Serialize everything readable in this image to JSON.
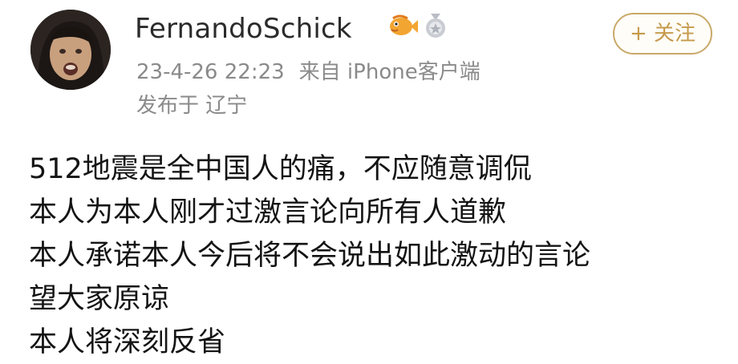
{
  "post": {
    "user": {
      "name": "FernandoSchick",
      "badges": [
        "fish-badge-icon",
        "medal-badge-icon"
      ]
    },
    "timestamp": "23-4-26 22:23",
    "source": "来自 iPhone客户端",
    "location": "发布于 辽宁",
    "follow_label": "+ 关注",
    "body_lines": [
      "512地震是全中国人的痛，不应随意调侃",
      "本人为本人刚才过激言论向所有人道歉",
      "本人承诺本人今后将不会说出如此激动的言论",
      "望大家原谅",
      "本人将深刻反省"
    ]
  },
  "colors": {
    "meta_gray": "#8a8a8a",
    "follow_gold": "#c59a4a",
    "text": "#141414"
  }
}
